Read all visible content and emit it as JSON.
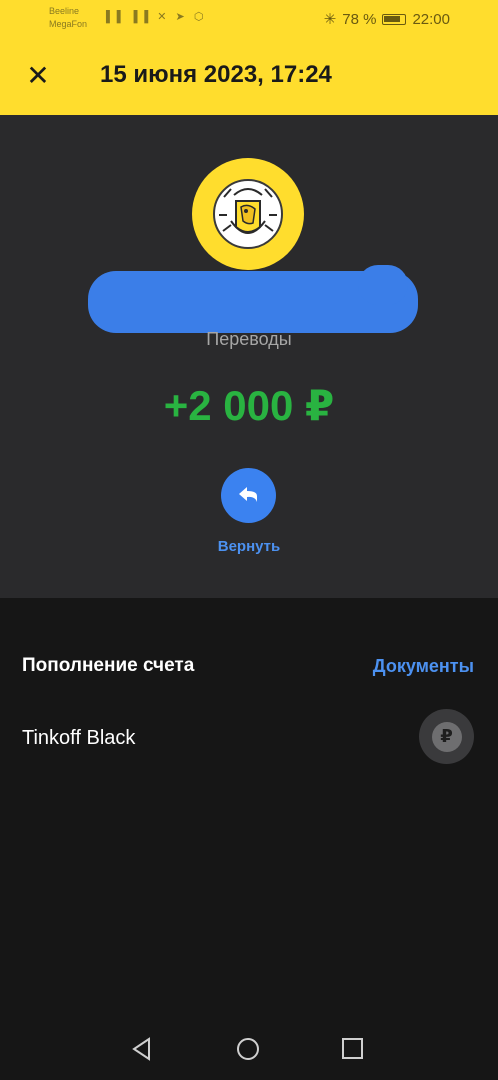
{
  "status_bar": {
    "carrier_1": "Beeline",
    "carrier_2": "MegaFon",
    "left_icons": "▐▐ ▐▐ ✕ ➤ ⬡",
    "battery_pct": "78 %",
    "time": "22:00"
  },
  "header": {
    "close_icon": "✕",
    "title": "15 июня 2023, 17:24"
  },
  "transaction": {
    "category": "Переводы",
    "amount": "+2 000 ₽",
    "return_label": "Вернуть"
  },
  "details": {
    "section_title": "Пополнение счета",
    "documents_link": "Документы",
    "account_name": "Tinkoff Black",
    "currency_symbol": "₽"
  },
  "colors": {
    "brand_yellow": "#ffdd2d",
    "amount_green": "#29b341",
    "link_blue": "#4c91f0"
  }
}
